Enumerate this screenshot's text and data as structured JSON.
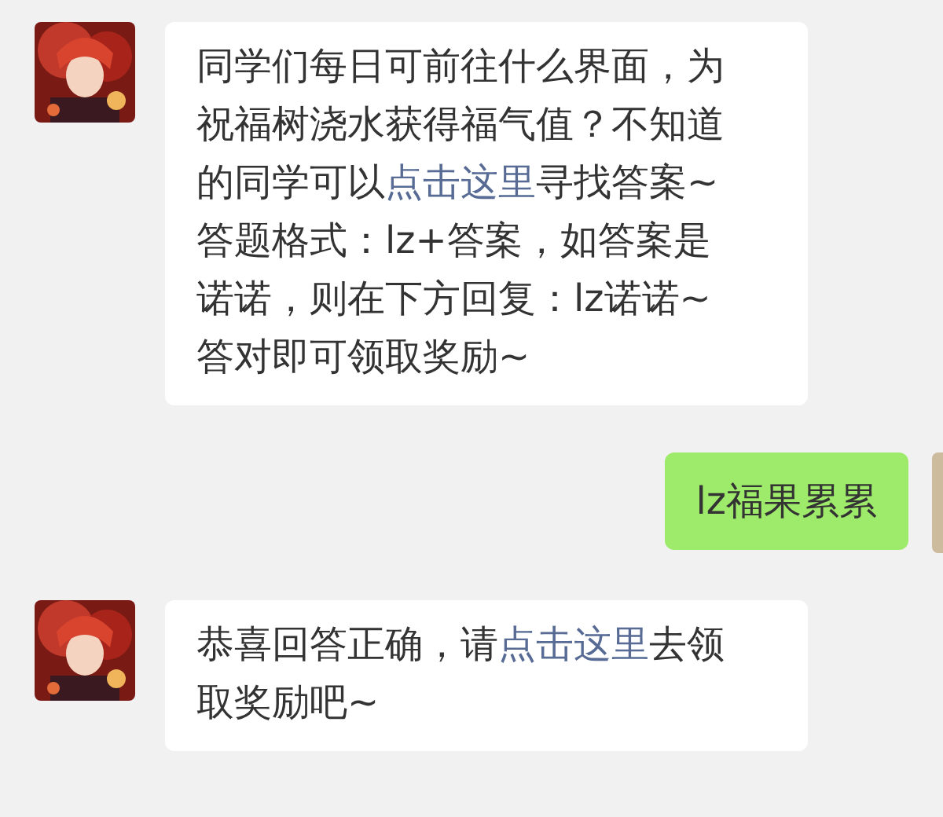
{
  "messages": [
    {
      "kind": "received",
      "paragraphs": [
        [
          {
            "text": "同学们每日可前往什么界面，为祝福树浇水获得福气值？不知道的同学可以",
            "link": false
          },
          {
            "text": "点击这里",
            "link": true
          },
          {
            "text": "寻找答案~",
            "link": false
          }
        ],
        [
          {
            "text": "答题格式：lz+答案，如答案是诺诺，则在下方回复：lz诺诺~",
            "link": false
          }
        ],
        [
          {
            "text": "答对即可领取奖励~",
            "link": false
          }
        ]
      ]
    },
    {
      "kind": "sent",
      "paragraphs": [
        [
          {
            "text": "lz福果累累",
            "link": false
          }
        ]
      ]
    },
    {
      "kind": "received",
      "paragraphs": [
        [
          {
            "text": "恭喜回答正确，请",
            "link": false
          },
          {
            "text": "点击这里",
            "link": true
          },
          {
            "text": "去领取奖励吧~",
            "link": false
          }
        ]
      ]
    }
  ]
}
